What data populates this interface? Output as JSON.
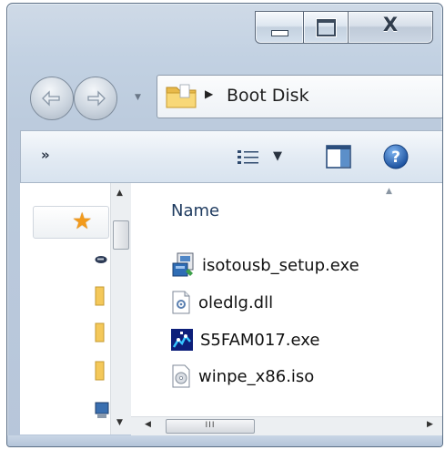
{
  "window": {
    "caption": {
      "close_label": "X"
    },
    "address": {
      "crumb": "Boot Disk"
    },
    "commandbar": {
      "overflow_label": "»"
    },
    "nav_pane": {
      "items": [
        {
          "icon": "star-icon"
        },
        {
          "icon": "drive-icon"
        },
        {
          "icon": "folder-icon"
        },
        {
          "icon": "folder-icon"
        },
        {
          "icon": "folder-icon"
        },
        {
          "icon": "computer-icon"
        }
      ]
    },
    "file_list": {
      "column_header": "Name",
      "files": [
        {
          "name": "isotousb_setup.exe",
          "icon": "installer-icon"
        },
        {
          "name": "oledlg.dll",
          "icon": "dll-file-icon"
        },
        {
          "name": "S5FAM017.exe",
          "icon": "exe-app-icon"
        },
        {
          "name": "winpe_x86.iso",
          "icon": "disc-image-icon"
        }
      ]
    },
    "scrollbar": {
      "thumb_grip": "III"
    }
  }
}
